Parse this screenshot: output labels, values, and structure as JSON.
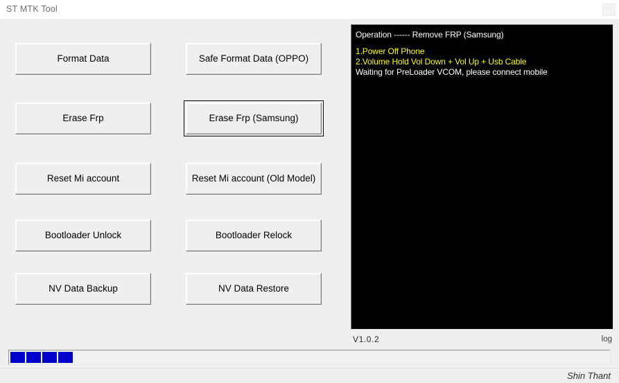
{
  "window": {
    "title": "ST MTK Tool",
    "titlebar_button": "window-control",
    "body_bg": "#efefef",
    "titlebar_bg": "#ffffff"
  },
  "buttons": [
    {
      "label": "Format Data",
      "col": 0,
      "row": 0,
      "focused": false
    },
    {
      "label": "Safe Format Data (OPPO)",
      "col": 1,
      "row": 0,
      "focused": false
    },
    {
      "label": "Erase Frp",
      "col": 0,
      "row": 1,
      "focused": false
    },
    {
      "label": "Erase Frp (Samsung)",
      "col": 1,
      "row": 1,
      "focused": true
    },
    {
      "label": "Reset Mi account",
      "col": 0,
      "row": 2,
      "focused": false
    },
    {
      "label": "Reset Mi account (Old Model)",
      "col": 1,
      "row": 2,
      "focused": false
    },
    {
      "label": "Bootloader Unlock",
      "col": 0,
      "row": 3,
      "focused": false
    },
    {
      "label": "Bootloader Relock",
      "col": 1,
      "row": 3,
      "focused": false
    },
    {
      "label": "NV Data Backup",
      "col": 0,
      "row": 4,
      "focused": false
    },
    {
      "label": "NV Data Restore",
      "col": 1,
      "row": 4,
      "focused": false
    }
  ],
  "console": {
    "background": "#000000",
    "lines": [
      {
        "text": "Operation ------ Remove FRP (Samsung)",
        "color": "#ffffff"
      },
      {
        "text": "",
        "color": "#ffffff"
      },
      {
        "text": "1.Power Off Phone",
        "color": "#ffff00"
      },
      {
        "text": "2.Volume Hold Vol Down + Vol Up + Usb Cable",
        "color": "#ffff00"
      },
      {
        "text": "Waiting for PreLoader VCOM, please connect mobile",
        "color": "#ffffff"
      }
    ]
  },
  "footer": {
    "version": "V1.0.2",
    "log_label": "log",
    "signature": "Shin Thant"
  },
  "progress": {
    "blocks": 4,
    "block_color": "#0000cc",
    "value_label": ""
  }
}
